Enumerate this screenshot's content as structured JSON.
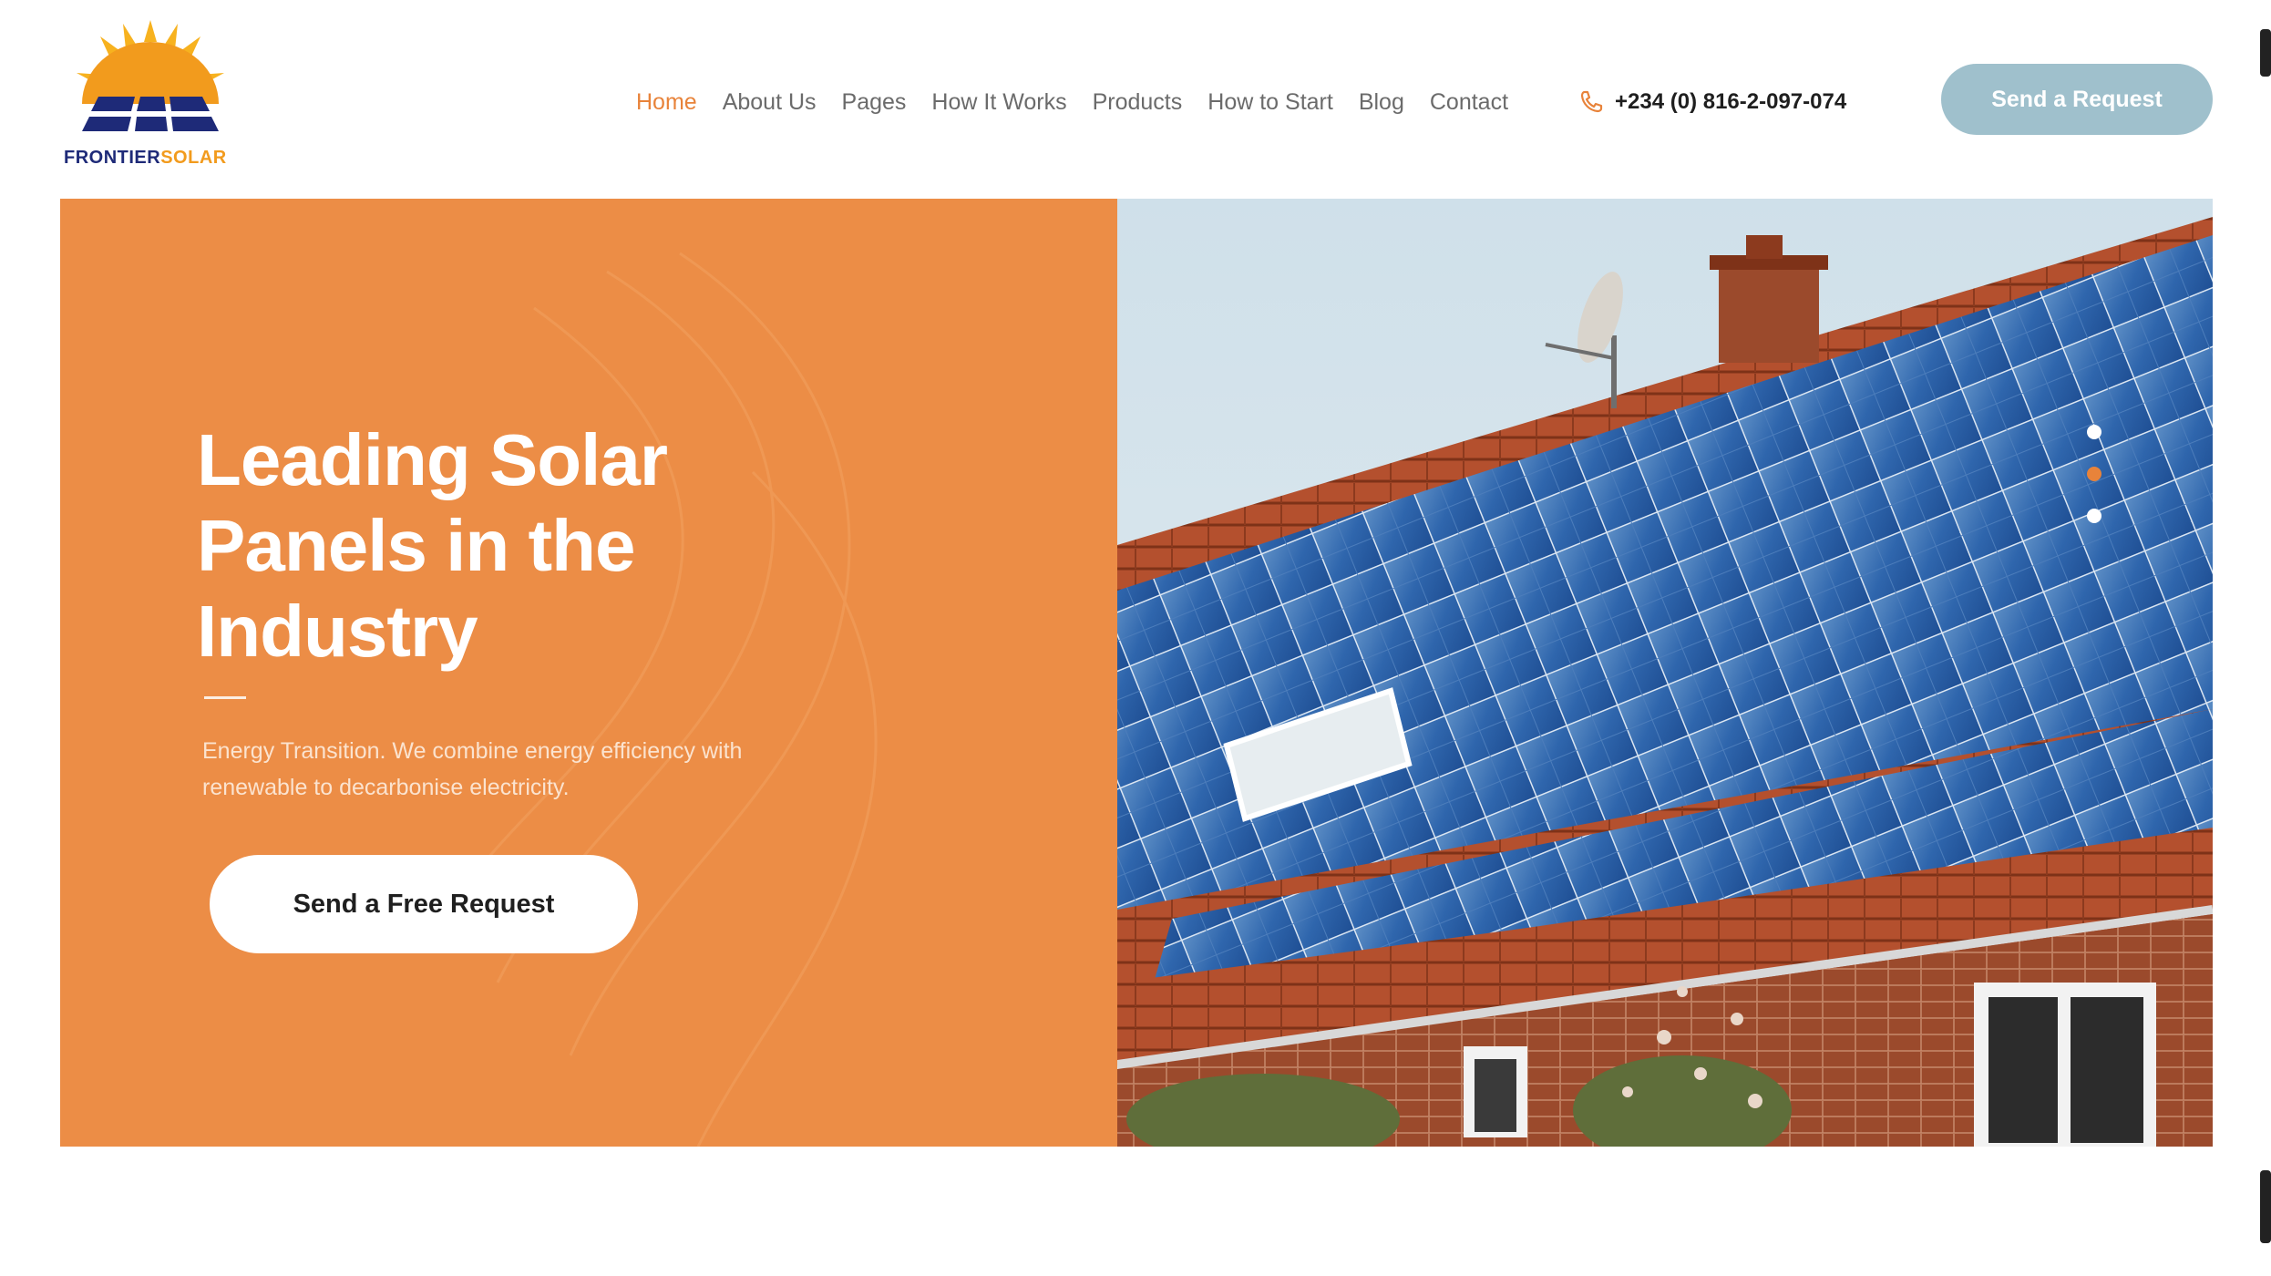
{
  "brand": {
    "name_part1": "FRONTIER",
    "name_part2": "SOLAR",
    "colors": {
      "navy": "#1e2a78",
      "sun": "#f29b1d"
    }
  },
  "nav": {
    "items": [
      {
        "label": "Home",
        "active": true
      },
      {
        "label": "About Us",
        "active": false
      },
      {
        "label": "Pages",
        "active": false
      },
      {
        "label": "How It Works",
        "active": false
      },
      {
        "label": "Products",
        "active": false
      },
      {
        "label": "How to Start",
        "active": false
      },
      {
        "label": "Blog",
        "active": false
      },
      {
        "label": "Contact",
        "active": false
      }
    ],
    "active_color": "#e8833a"
  },
  "contact": {
    "phone": "+234 (0) 816-2-097-074",
    "icon": "phone-icon"
  },
  "header": {
    "cta_label": "Send a Request"
  },
  "hero": {
    "headline": "Leading Solar\nPanels in the\nIndustry",
    "subtitle": "Energy Transition. We combine energy efficiency with renewable to decarbonise electricity.",
    "cta_label": "Send a Free Request",
    "accent_color": "#ec8d46",
    "image": "rooftop-solar-panels",
    "slider": {
      "count": 3,
      "active_index": 1
    }
  }
}
